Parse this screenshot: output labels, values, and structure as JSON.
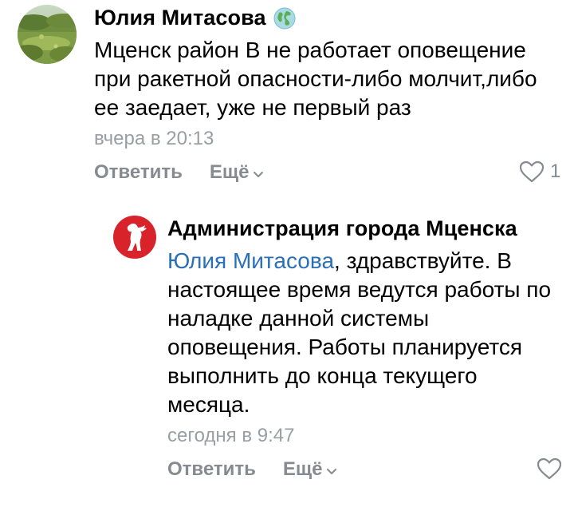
{
  "comments": [
    {
      "author": "Юлия Митасова",
      "avatar_icon": "landscape-avatar",
      "badge_icon": "globe-icon",
      "text_lines": [
        "Мценск район В не работает оповещение",
        "при ракетной опасности-либо молчит,либо",
        "ее заедает, уже не первый раз"
      ],
      "time": "вчера в 20:13",
      "reply_label": "Ответить",
      "more_label": "Ещё",
      "likes": "1"
    },
    {
      "author": "Администрация города Мценска",
      "avatar_icon": "city-emblem-avatar",
      "mention": "Юлия Митасова",
      "text_first_rest": ", здравствуйте. В",
      "text_lines": [
        "настоящее время ведутся работы по",
        "наладке данной системы",
        "оповещения. Работы планируется",
        "выполнить до конца текущего",
        "месяца."
      ],
      "time": "сегодня в 9:47",
      "reply_label": "Ответить",
      "more_label": "Ещё"
    }
  ],
  "colors": {
    "mention": "#2a6fba",
    "meta": "#9a9ea4",
    "action": "#868b91",
    "emblem_red": "#d8232a"
  }
}
